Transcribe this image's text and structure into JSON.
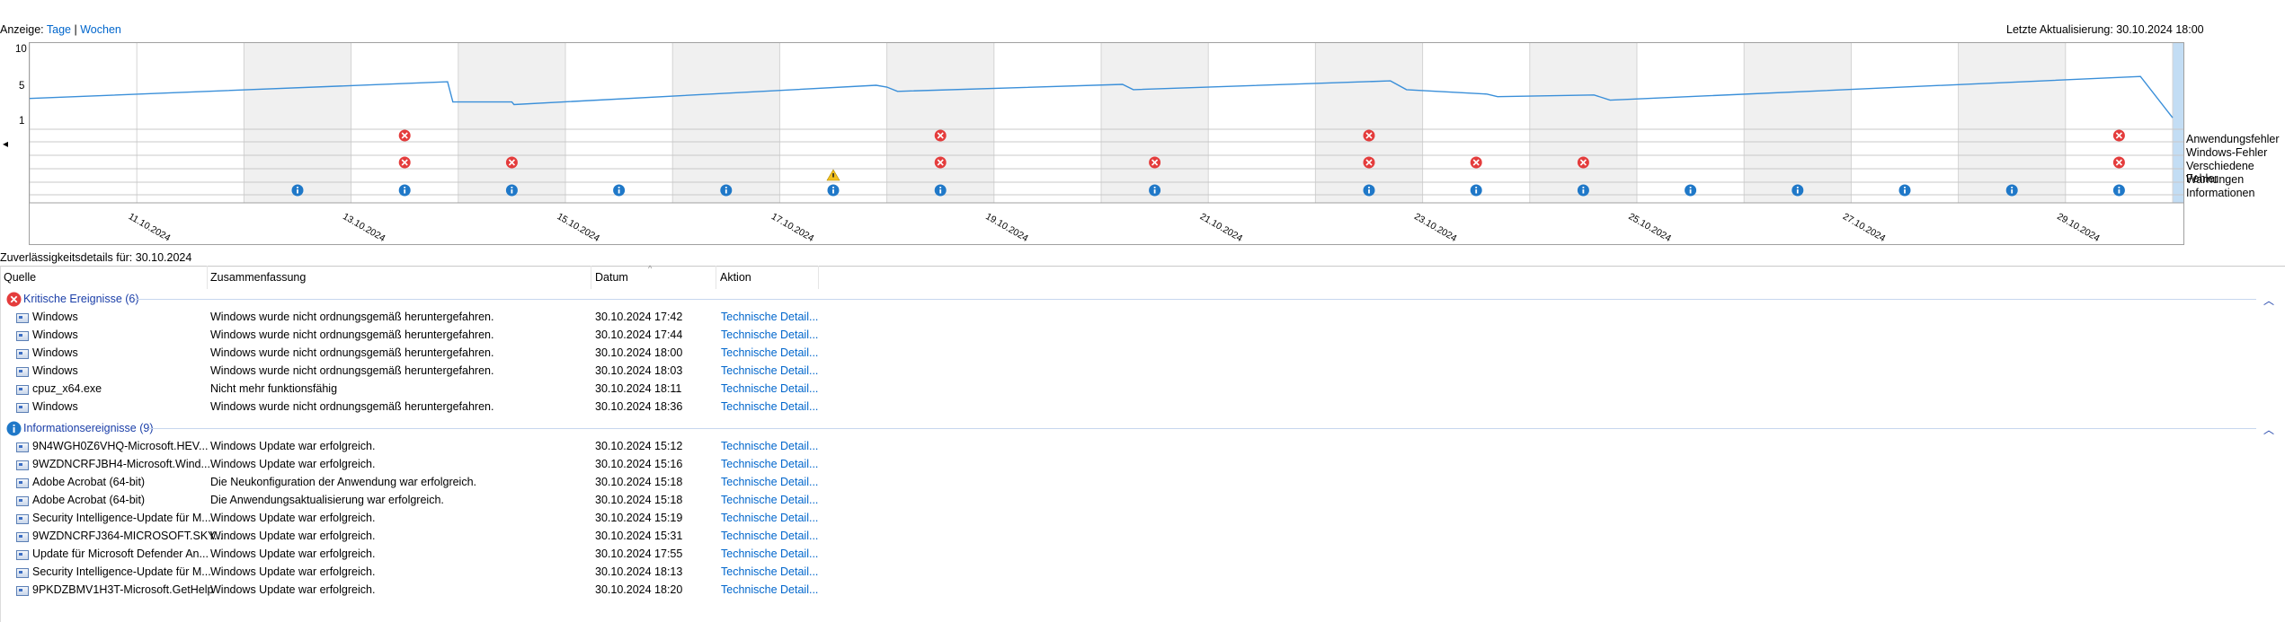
{
  "header": {
    "view_prefix": "Anzeige:",
    "view_tage": "Tage",
    "view_sep": "|",
    "view_wochen": "Wochen",
    "last_update": "Letzte Aktualisierung: 30.10.2024 18:00"
  },
  "chart": {
    "y_ticks": [
      "10",
      "5",
      "1"
    ],
    "nav_left": "◂",
    "nav_right": "▸",
    "legend": [
      "Anwendungsfehler",
      "Windows-Fehler",
      "Verschiedene Fehler",
      "Warnungen",
      "Informationen"
    ],
    "date_labels": [
      "11.10.2024",
      "13.10.2024",
      "15.10.2024",
      "17.10.2024",
      "19.10.2024",
      "21.10.2024",
      "23.10.2024",
      "25.10.2024",
      "27.10.2024",
      "29.10.2024"
    ],
    "colors": {
      "line": "#3a8fd9",
      "selected": "#c3ddf4",
      "shade": "#f0f0f0",
      "error": "#e43c3c",
      "info": "#1f78c8",
      "warning": "#f2c01e"
    }
  },
  "chart_data": {
    "type": "line",
    "days": [
      "10.10.2024",
      "11.10.2024",
      "12.10.2024",
      "13.10.2024",
      "14.10.2024",
      "15.10.2024",
      "16.10.2024",
      "17.10.2024",
      "18.10.2024",
      "19.10.2024",
      "20.10.2024",
      "21.10.2024",
      "22.10.2024",
      "23.10.2024",
      "24.10.2024",
      "25.10.2024",
      "26.10.2024",
      "27.10.2024",
      "28.10.2024",
      "29.10.2024"
    ],
    "ylim": [
      1,
      10
    ],
    "selected_day": "30.10.2024",
    "stability_index": [
      {
        "x": 0.0,
        "y": 4.0
      },
      {
        "x": 3.9,
        "y": 5.9
      },
      {
        "x": 3.95,
        "y": 3.6
      },
      {
        "x": 4.5,
        "y": 3.6
      },
      {
        "x": 4.52,
        "y": 3.3
      },
      {
        "x": 7.9,
        "y": 5.5
      },
      {
        "x": 8.0,
        "y": 5.3
      },
      {
        "x": 8.1,
        "y": 4.8
      },
      {
        "x": 10.2,
        "y": 5.6
      },
      {
        "x": 10.3,
        "y": 5.0
      },
      {
        "x": 12.7,
        "y": 6.0
      },
      {
        "x": 12.85,
        "y": 5.0
      },
      {
        "x": 13.6,
        "y": 4.5
      },
      {
        "x": 13.7,
        "y": 4.2
      },
      {
        "x": 14.6,
        "y": 4.4
      },
      {
        "x": 14.75,
        "y": 3.8
      },
      {
        "x": 19.7,
        "y": 6.5
      },
      {
        "x": 20.0,
        "y": 1.8
      }
    ],
    "events": {
      "Anwendungsfehler": [
        3,
        8,
        12,
        19
      ],
      "Windows-Fehler": [],
      "Verschiedene Fehler": [
        3,
        4,
        8,
        10,
        12,
        13,
        14,
        19
      ],
      "Warnungen": [
        7
      ],
      "Informationen": [
        2,
        3,
        4,
        5,
        6,
        7,
        8,
        10,
        12,
        13,
        14,
        15,
        16,
        17,
        18,
        19
      ]
    }
  },
  "details": {
    "title": "Zuverlässigkeitsdetails für: 30.10.2024",
    "columns": [
      "Quelle",
      "Zusammenfassung",
      "Datum",
      "Aktion"
    ],
    "groups": [
      {
        "title": "Kritische Ereignisse (6)",
        "icon": "error-icon",
        "rows": [
          [
            "Windows",
            "Windows wurde nicht ordnungsgemäß heruntergefahren.",
            "30.10.2024 17:42",
            "Technische Detail..."
          ],
          [
            "Windows",
            "Windows wurde nicht ordnungsgemäß heruntergefahren.",
            "30.10.2024 17:44",
            "Technische Detail..."
          ],
          [
            "Windows",
            "Windows wurde nicht ordnungsgemäß heruntergefahren.",
            "30.10.2024 18:00",
            "Technische Detail..."
          ],
          [
            "Windows",
            "Windows wurde nicht ordnungsgemäß heruntergefahren.",
            "30.10.2024 18:03",
            "Technische Detail..."
          ],
          [
            "cpuz_x64.exe",
            "Nicht mehr funktionsfähig",
            "30.10.2024 18:11",
            "Technische Detail..."
          ],
          [
            "Windows",
            "Windows wurde nicht ordnungsgemäß heruntergefahren.",
            "30.10.2024 18:36",
            "Technische Detail..."
          ]
        ]
      },
      {
        "title": "Informationsereignisse (9)",
        "icon": "info-icon",
        "rows": [
          [
            "9N4WGH0Z6VHQ-Microsoft.HEV...",
            "Windows Update war erfolgreich.",
            "30.10.2024 15:12",
            "Technische Detail..."
          ],
          [
            "9WZDNCRFJBH4-Microsoft.Wind...",
            "Windows Update war erfolgreich.",
            "30.10.2024 15:16",
            "Technische Detail..."
          ],
          [
            "Adobe Acrobat (64-bit)",
            "Die Neukonfiguration der Anwendung war erfolgreich.",
            "30.10.2024 15:18",
            "Technische Detail..."
          ],
          [
            "Adobe Acrobat (64-bit)",
            "Die Anwendungsaktualisierung war erfolgreich.",
            "30.10.2024 15:18",
            "Technische Detail..."
          ],
          [
            "Security Intelligence-Update für M...",
            "Windows Update war erfolgreich.",
            "30.10.2024 15:19",
            "Technische Detail..."
          ],
          [
            "9WZDNCRFJ364-MICROSOFT.SKY...",
            "Windows Update war erfolgreich.",
            "30.10.2024 15:31",
            "Technische Detail..."
          ],
          [
            "Update für Microsoft Defender An...",
            "Windows Update war erfolgreich.",
            "30.10.2024 17:55",
            "Technische Detail..."
          ],
          [
            "Security Intelligence-Update für M...",
            "Windows Update war erfolgreich.",
            "30.10.2024 18:13",
            "Technische Detail..."
          ],
          [
            "9PKDZBMV1H3T-Microsoft.GetHelp",
            "Windows Update war erfolgreich.",
            "30.10.2024 18:20",
            "Technische Detail..."
          ]
        ]
      }
    ]
  }
}
